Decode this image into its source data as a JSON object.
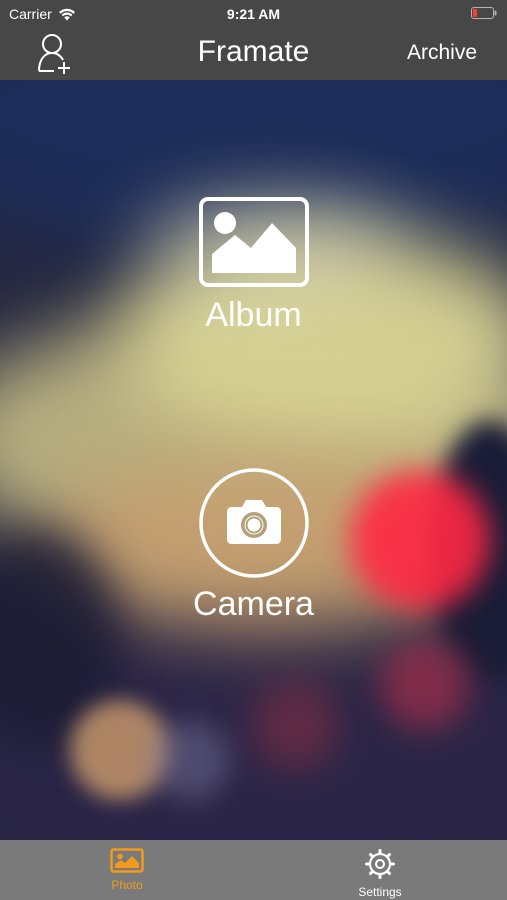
{
  "status_bar": {
    "carrier": "Carrier",
    "time": "9:21 AM",
    "icons": {
      "wifi": "wifi-icon",
      "battery": "battery-low-icon"
    },
    "battery_color": "#ff3b30"
  },
  "nav": {
    "title": "Framate",
    "left_icon": "add-user-icon",
    "right_label": "Archive"
  },
  "main": {
    "album": {
      "label": "Album",
      "icon": "image-icon"
    },
    "camera": {
      "label": "Camera",
      "icon": "camera-icon"
    }
  },
  "tab_bar": {
    "active_color": "#f29a1e",
    "inactive_color": "#ffffff",
    "tabs": [
      {
        "label": "Photo",
        "icon": "photo-icon",
        "selected": true
      },
      {
        "label": "Settings",
        "icon": "gear-icon",
        "selected": false
      }
    ]
  }
}
